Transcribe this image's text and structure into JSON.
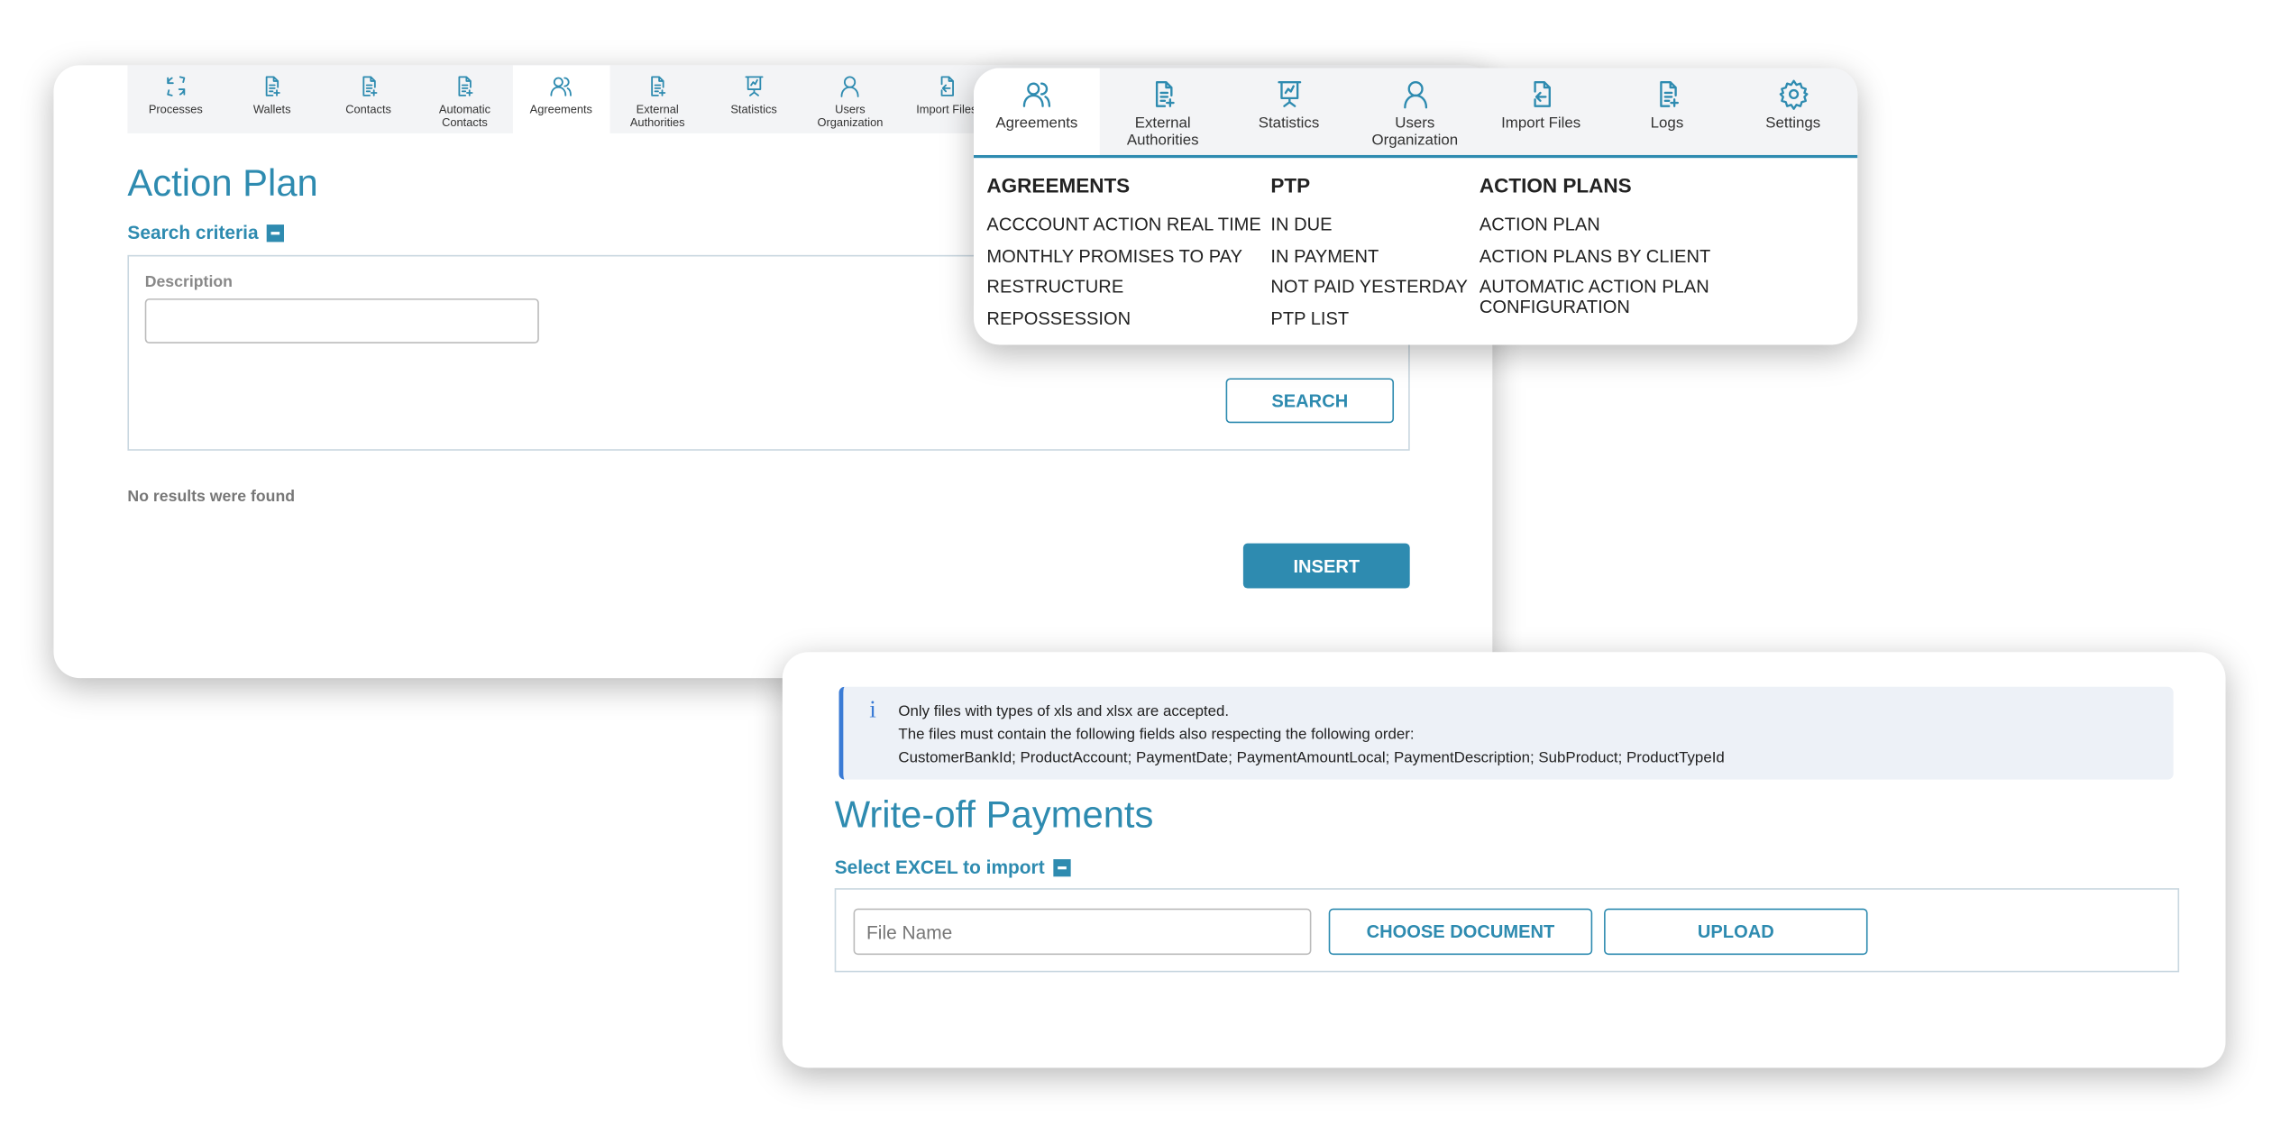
{
  "main_nav": {
    "items": [
      {
        "label": "Processes",
        "icon": "sync-icon"
      },
      {
        "label": "Wallets",
        "icon": "document-plus-icon"
      },
      {
        "label": "Contacts",
        "icon": "document-plus-icon"
      },
      {
        "label": "Automatic Contacts",
        "icon": "document-plus-icon"
      },
      {
        "label": "Agreements",
        "icon": "users-icon",
        "active": true
      },
      {
        "label": "External Authorities",
        "icon": "document-plus-icon"
      },
      {
        "label": "Statistics",
        "icon": "presentation-icon"
      },
      {
        "label": "Users Organization",
        "icon": "user-icon"
      },
      {
        "label": "Import Files",
        "icon": "file-import-icon"
      }
    ]
  },
  "action_plan": {
    "title": "Action Plan",
    "search_criteria": "Search criteria",
    "description_label": "Description",
    "description_value": "",
    "search_button": "SEARCH",
    "no_results": "No results were found",
    "insert_button": "INSERT"
  },
  "menu": {
    "tabs": [
      {
        "label": "Agreements",
        "icon": "users-icon",
        "active": true
      },
      {
        "label": "External Authorities",
        "icon": "document-plus-icon"
      },
      {
        "label": "Statistics",
        "icon": "presentation-icon"
      },
      {
        "label": "Users Organization",
        "icon": "user-icon"
      },
      {
        "label": "Import Files",
        "icon": "file-import-icon"
      },
      {
        "label": "Logs",
        "icon": "document-plus-icon"
      },
      {
        "label": "Settings",
        "icon": "gear-icon"
      }
    ],
    "columns": [
      {
        "heading": "AGREEMENTS",
        "items": [
          "ACCCOUNT ACTION REAL TIME",
          "MONTHLY PROMISES TO PAY",
          "RESTRUCTURE",
          "REPOSSESSION"
        ]
      },
      {
        "heading": "PTP",
        "items": [
          "IN DUE",
          "IN PAYMENT",
          "NOT PAID YESTERDAY",
          "PTP LIST"
        ]
      },
      {
        "heading": "ACTION PLANS",
        "items": [
          "ACTION PLAN",
          "ACTION PLANS BY CLIENT",
          "AUTOMATIC ACTION PLAN CONFIGURATION"
        ]
      }
    ]
  },
  "writeoff": {
    "info_lines": [
      "Only files with types of xls and xlsx are accepted.",
      "The files must contain the following fields also respecting the following order:",
      "CustomerBankId; ProductAccount; PaymentDate; PaymentAmountLocal; PaymentDescription; SubProduct; ProductTypeId"
    ],
    "title": "Write-off Payments",
    "section": "Select EXCEL to import",
    "file_placeholder": "File Name",
    "choose_button": "CHOOSE DOCUMENT",
    "upload_button": "UPLOAD"
  },
  "colors": {
    "accent": "#2e8bb0",
    "info_border": "#3a7bd5",
    "info_bg": "#edf1f7"
  }
}
